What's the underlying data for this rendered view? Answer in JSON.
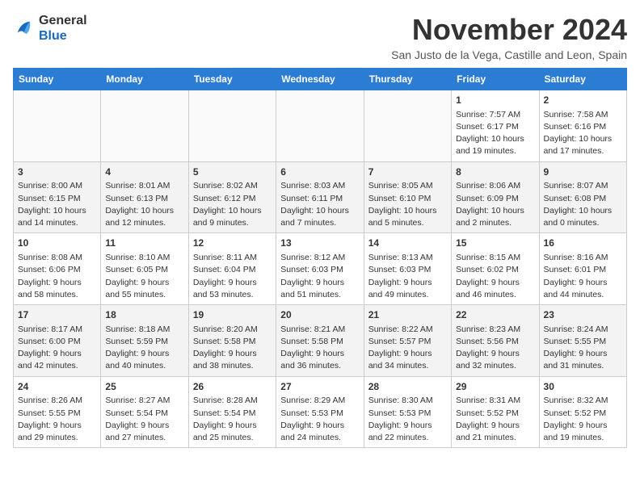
{
  "logo": {
    "general": "General",
    "blue": "Blue"
  },
  "header": {
    "month": "November 2024",
    "location": "San Justo de la Vega, Castille and Leon, Spain"
  },
  "days_of_week": [
    "Sunday",
    "Monday",
    "Tuesday",
    "Wednesday",
    "Thursday",
    "Friday",
    "Saturday"
  ],
  "weeks": [
    [
      {
        "day": "",
        "info": ""
      },
      {
        "day": "",
        "info": ""
      },
      {
        "day": "",
        "info": ""
      },
      {
        "day": "",
        "info": ""
      },
      {
        "day": "",
        "info": ""
      },
      {
        "day": "1",
        "info": "Sunrise: 7:57 AM\nSunset: 6:17 PM\nDaylight: 10 hours and 19 minutes."
      },
      {
        "day": "2",
        "info": "Sunrise: 7:58 AM\nSunset: 6:16 PM\nDaylight: 10 hours and 17 minutes."
      }
    ],
    [
      {
        "day": "3",
        "info": "Sunrise: 8:00 AM\nSunset: 6:15 PM\nDaylight: 10 hours and 14 minutes."
      },
      {
        "day": "4",
        "info": "Sunrise: 8:01 AM\nSunset: 6:13 PM\nDaylight: 10 hours and 12 minutes."
      },
      {
        "day": "5",
        "info": "Sunrise: 8:02 AM\nSunset: 6:12 PM\nDaylight: 10 hours and 9 minutes."
      },
      {
        "day": "6",
        "info": "Sunrise: 8:03 AM\nSunset: 6:11 PM\nDaylight: 10 hours and 7 minutes."
      },
      {
        "day": "7",
        "info": "Sunrise: 8:05 AM\nSunset: 6:10 PM\nDaylight: 10 hours and 5 minutes."
      },
      {
        "day": "8",
        "info": "Sunrise: 8:06 AM\nSunset: 6:09 PM\nDaylight: 10 hours and 2 minutes."
      },
      {
        "day": "9",
        "info": "Sunrise: 8:07 AM\nSunset: 6:08 PM\nDaylight: 10 hours and 0 minutes."
      }
    ],
    [
      {
        "day": "10",
        "info": "Sunrise: 8:08 AM\nSunset: 6:06 PM\nDaylight: 9 hours and 58 minutes."
      },
      {
        "day": "11",
        "info": "Sunrise: 8:10 AM\nSunset: 6:05 PM\nDaylight: 9 hours and 55 minutes."
      },
      {
        "day": "12",
        "info": "Sunrise: 8:11 AM\nSunset: 6:04 PM\nDaylight: 9 hours and 53 minutes."
      },
      {
        "day": "13",
        "info": "Sunrise: 8:12 AM\nSunset: 6:03 PM\nDaylight: 9 hours and 51 minutes."
      },
      {
        "day": "14",
        "info": "Sunrise: 8:13 AM\nSunset: 6:03 PM\nDaylight: 9 hours and 49 minutes."
      },
      {
        "day": "15",
        "info": "Sunrise: 8:15 AM\nSunset: 6:02 PM\nDaylight: 9 hours and 46 minutes."
      },
      {
        "day": "16",
        "info": "Sunrise: 8:16 AM\nSunset: 6:01 PM\nDaylight: 9 hours and 44 minutes."
      }
    ],
    [
      {
        "day": "17",
        "info": "Sunrise: 8:17 AM\nSunset: 6:00 PM\nDaylight: 9 hours and 42 minutes."
      },
      {
        "day": "18",
        "info": "Sunrise: 8:18 AM\nSunset: 5:59 PM\nDaylight: 9 hours and 40 minutes."
      },
      {
        "day": "19",
        "info": "Sunrise: 8:20 AM\nSunset: 5:58 PM\nDaylight: 9 hours and 38 minutes."
      },
      {
        "day": "20",
        "info": "Sunrise: 8:21 AM\nSunset: 5:58 PM\nDaylight: 9 hours and 36 minutes."
      },
      {
        "day": "21",
        "info": "Sunrise: 8:22 AM\nSunset: 5:57 PM\nDaylight: 9 hours and 34 minutes."
      },
      {
        "day": "22",
        "info": "Sunrise: 8:23 AM\nSunset: 5:56 PM\nDaylight: 9 hours and 32 minutes."
      },
      {
        "day": "23",
        "info": "Sunrise: 8:24 AM\nSunset: 5:55 PM\nDaylight: 9 hours and 31 minutes."
      }
    ],
    [
      {
        "day": "24",
        "info": "Sunrise: 8:26 AM\nSunset: 5:55 PM\nDaylight: 9 hours and 29 minutes."
      },
      {
        "day": "25",
        "info": "Sunrise: 8:27 AM\nSunset: 5:54 PM\nDaylight: 9 hours and 27 minutes."
      },
      {
        "day": "26",
        "info": "Sunrise: 8:28 AM\nSunset: 5:54 PM\nDaylight: 9 hours and 25 minutes."
      },
      {
        "day": "27",
        "info": "Sunrise: 8:29 AM\nSunset: 5:53 PM\nDaylight: 9 hours and 24 minutes."
      },
      {
        "day": "28",
        "info": "Sunrise: 8:30 AM\nSunset: 5:53 PM\nDaylight: 9 hours and 22 minutes."
      },
      {
        "day": "29",
        "info": "Sunrise: 8:31 AM\nSunset: 5:52 PM\nDaylight: 9 hours and 21 minutes."
      },
      {
        "day": "30",
        "info": "Sunrise: 8:32 AM\nSunset: 5:52 PM\nDaylight: 9 hours and 19 minutes."
      }
    ]
  ]
}
